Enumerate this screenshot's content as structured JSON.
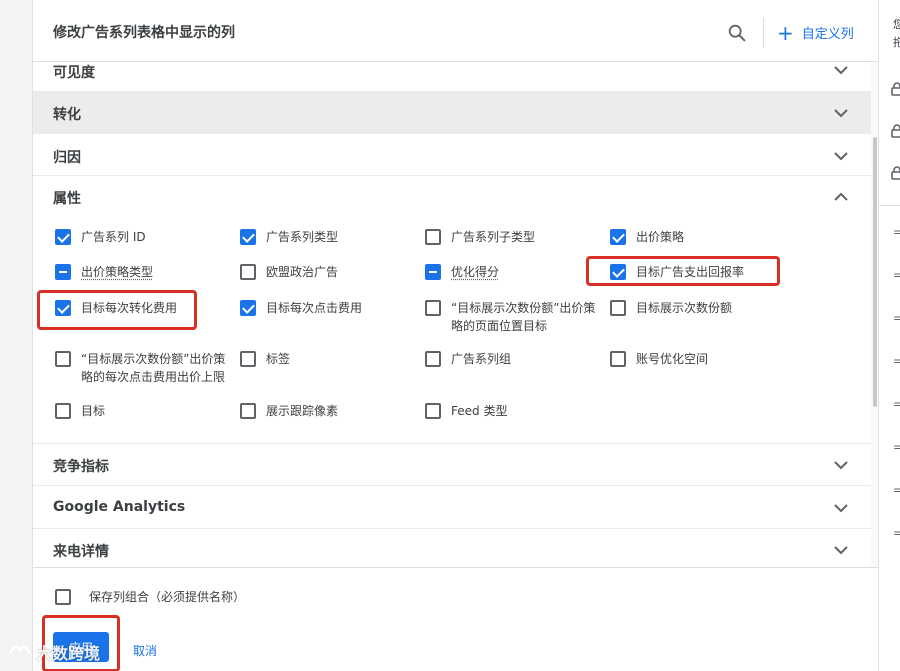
{
  "header": {
    "title": "修改广告系列表格中显示的列",
    "add_columns_label": "自定义列"
  },
  "sections_top": [
    {
      "label": "可见度"
    },
    {
      "label": "转化"
    },
    {
      "label": "归因"
    },
    {
      "label": "属性"
    }
  ],
  "attributes": [
    {
      "label": "广告系列 ID",
      "state": "checked"
    },
    {
      "label": "广告系列类型",
      "state": "checked"
    },
    {
      "label": "广告系列子类型",
      "state": "unchecked"
    },
    {
      "label": "出价策略",
      "state": "checked"
    },
    {
      "label": "出价策略类型",
      "state": "partial"
    },
    {
      "label": "欧盟政治广告",
      "state": "unchecked"
    },
    {
      "label": "优化得分",
      "state": "partial"
    },
    {
      "label": "目标广告支出回报率",
      "state": "checked"
    },
    {
      "label": "目标每次转化费用",
      "state": "checked"
    },
    {
      "label": "目标每次点击费用",
      "state": "checked"
    },
    {
      "label": "“目标展示次数份额”出价策略的页面位置目标",
      "state": "unchecked"
    },
    {
      "label": "目标展示次数份额",
      "state": "unchecked"
    },
    {
      "label": "“目标展示次数份额”出价策略的每次点击费用出价上限",
      "state": "unchecked"
    },
    {
      "label": "标签",
      "state": "unchecked"
    },
    {
      "label": "广告系列组",
      "state": "unchecked"
    },
    {
      "label": "账号优化空间",
      "state": "unchecked"
    },
    {
      "label": "目标",
      "state": "unchecked"
    },
    {
      "label": "展示跟踪像素",
      "state": "unchecked"
    },
    {
      "label": "Feed 类型",
      "state": "unchecked"
    }
  ],
  "sections_bottom": [
    {
      "label": "竞争指标"
    },
    {
      "label": "Google Analytics"
    },
    {
      "label": "来电详情"
    }
  ],
  "footer": {
    "save_combo_label": "保存列组合（必须提供名称）",
    "apply_label": "应用",
    "cancel_label": "取消"
  },
  "right_panel": {
    "text_1": "您",
    "text_2": "拖"
  },
  "watermark": {
    "text": "大数跨境"
  },
  "colors": {
    "accent": "#1a73e8",
    "highlight": "#d93025",
    "active_section_bg": "#ececec"
  },
  "icons": {
    "search": "search-icon",
    "add": "plus-icon",
    "chevron_down": "chevron-down-icon",
    "chevron_up": "chevron-up-icon",
    "lock": "lock-icon",
    "drag": "drag-handle-icon"
  }
}
